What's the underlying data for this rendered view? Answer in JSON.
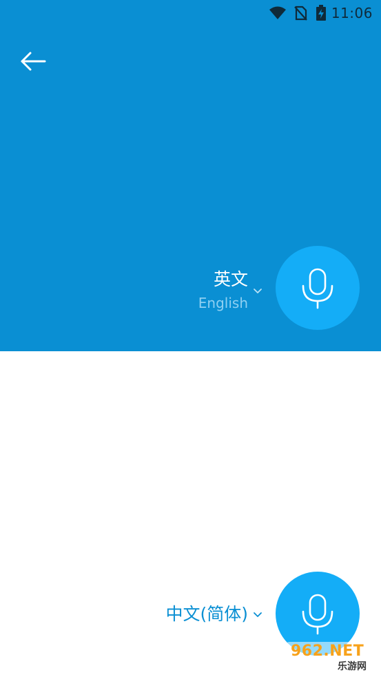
{
  "status_bar": {
    "time": "11:06",
    "icons": [
      "wifi-icon",
      "no-sim-icon",
      "battery-charging-icon"
    ]
  },
  "header": {
    "back_icon": "arrow-left-icon"
  },
  "source": {
    "language_name": "英文",
    "language_subtitle": "English",
    "dropdown_icon": "chevron-down-icon",
    "mic_icon": "microphone-icon"
  },
  "target": {
    "language_name": "中文(简体)",
    "dropdown_icon": "chevron-down-icon",
    "mic_icon": "microphone-icon"
  },
  "watermark": {
    "main": "962.NET",
    "sub": "乐游网"
  },
  "colors": {
    "top_panel": "#0a8fd3",
    "mic_button": "#14adf7",
    "subtitle": "#8fd0f2",
    "target_text": "#0a8fd3"
  }
}
